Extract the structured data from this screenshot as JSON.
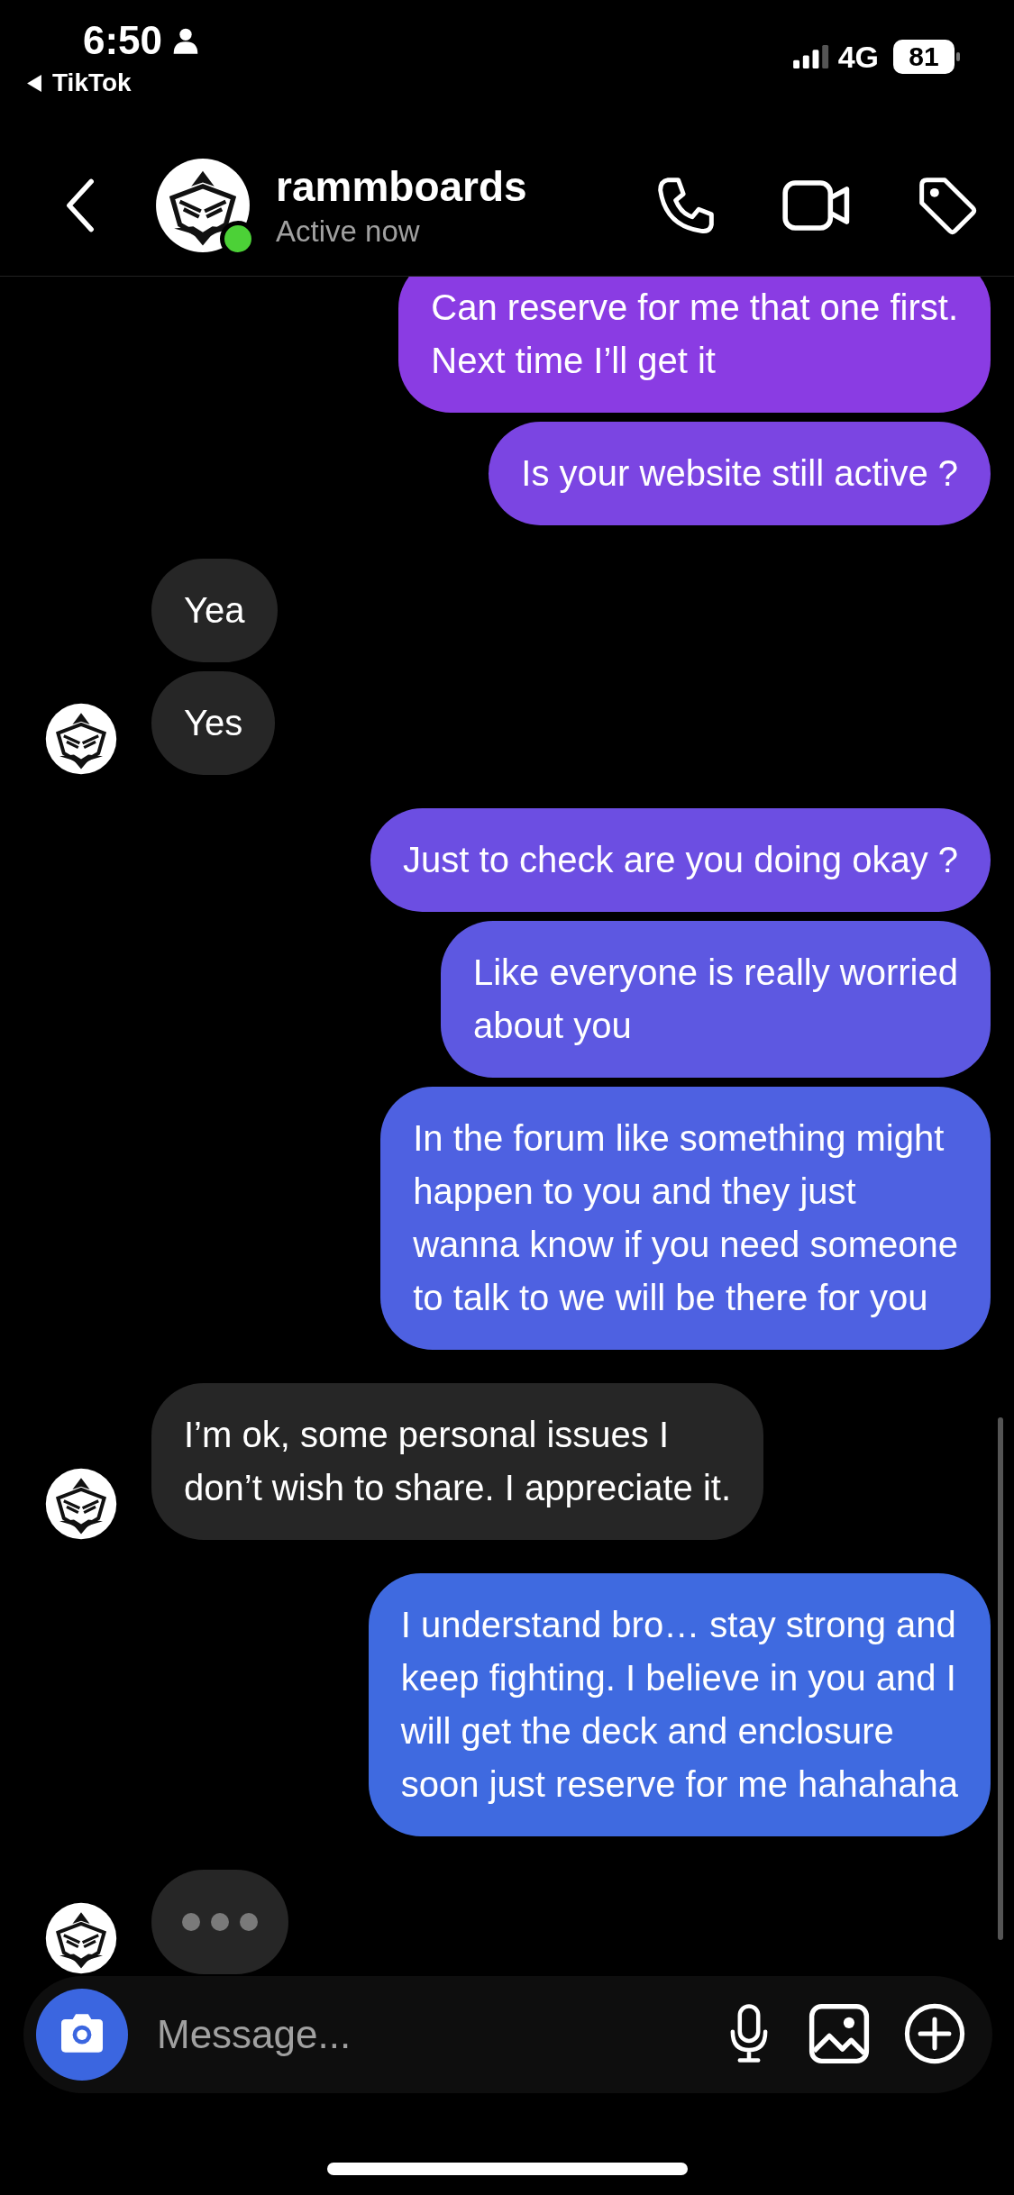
{
  "status_bar": {
    "time": "6:50",
    "back_app": "TikTok",
    "network": "4G",
    "battery": "81"
  },
  "header": {
    "name": "rammboards",
    "status": "Active now",
    "online": true
  },
  "messages": [
    {
      "kind": "text",
      "from_me": true,
      "text": "Can reserve for me that one first.\nNext time I’ll get it"
    },
    {
      "kind": "text",
      "from_me": true,
      "text": "Is your website still active ?"
    },
    {
      "kind": "text",
      "from_me": false,
      "text": "Yea",
      "avatar": false
    },
    {
      "kind": "text",
      "from_me": false,
      "text": "Yes",
      "avatar": true
    },
    {
      "kind": "text",
      "from_me": true,
      "text": "Just to check are you doing okay ?"
    },
    {
      "kind": "text",
      "from_me": true,
      "text": "Like everyone is really worried\nabout you"
    },
    {
      "kind": "text",
      "from_me": true,
      "text": "In the forum like something might\nhappen to you and they just\nwanna know if you need someone\nto talk to we will be there for you"
    },
    {
      "kind": "text",
      "from_me": false,
      "text": "I’m ok, some personal issues I\ndon’t wish to share. I appreciate it.",
      "avatar": true
    },
    {
      "kind": "text",
      "from_me": true,
      "text": "I understand bro… stay strong and\nkeep fighting. I believe in you and I\nwill get the deck and enclosure\nsoon just reserve for me hahahaha"
    },
    {
      "kind": "typing",
      "from_me": false,
      "avatar": true
    }
  ],
  "composer": {
    "placeholder": "Message..."
  }
}
